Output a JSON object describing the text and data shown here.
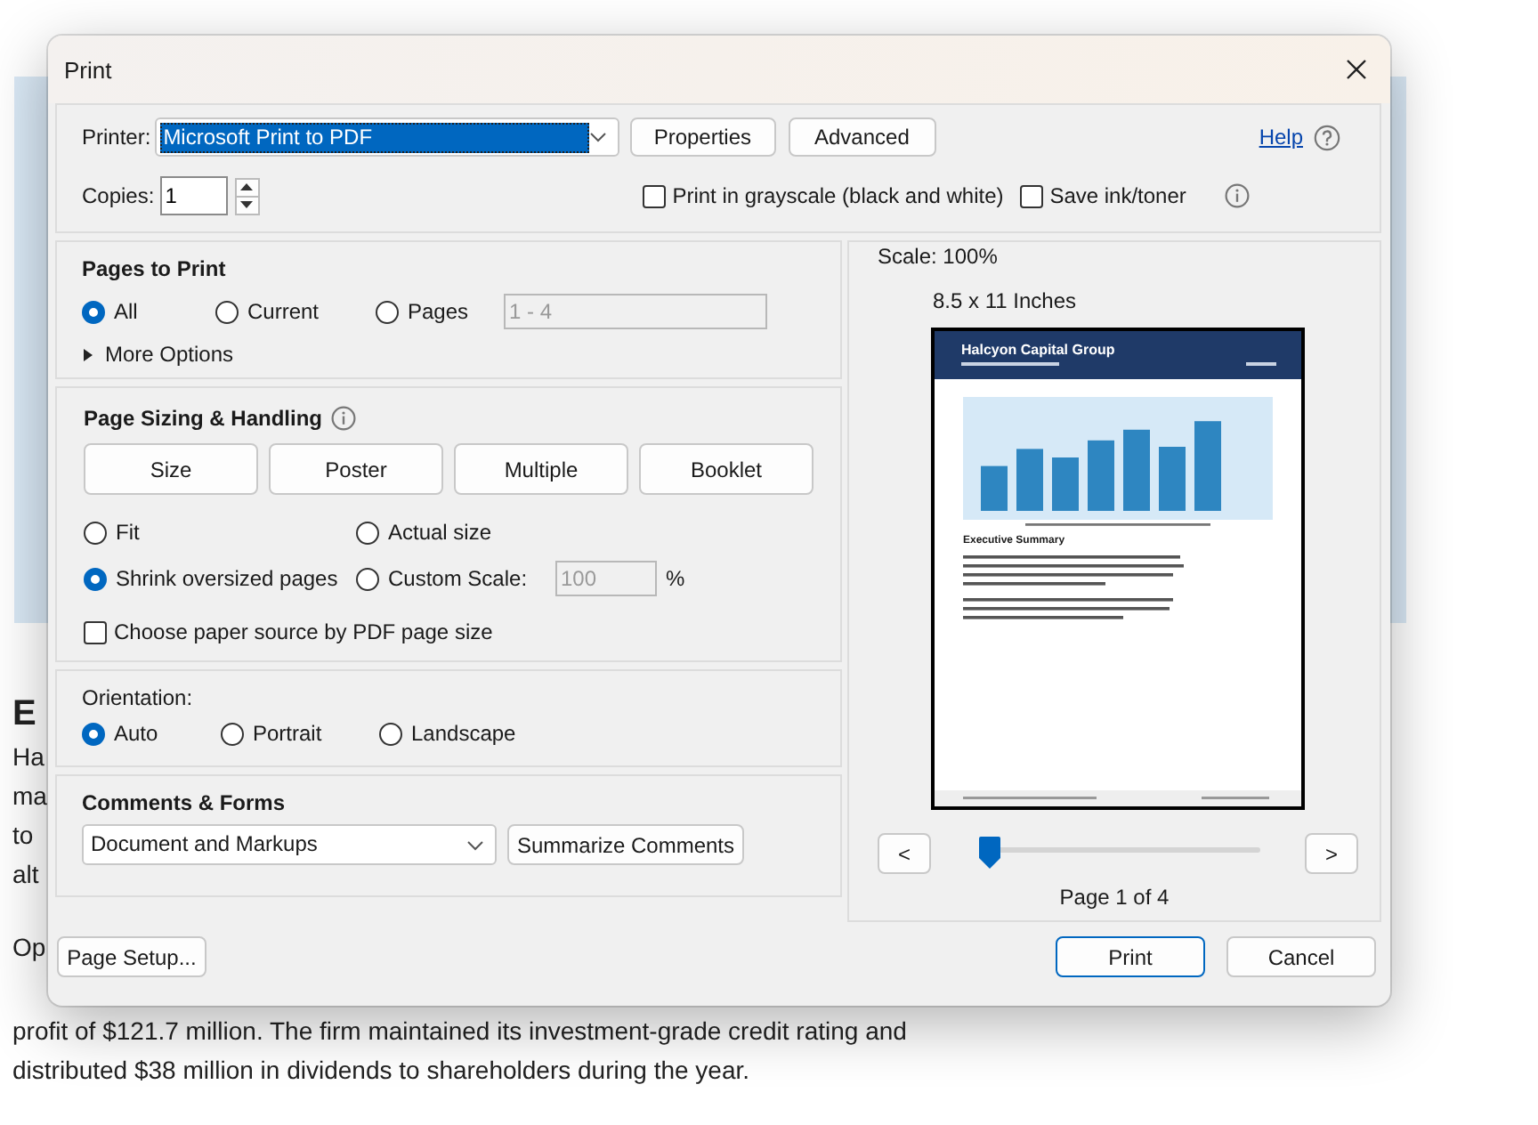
{
  "background_document": {
    "heading": "E",
    "paragraph_1": [
      "Ha",
      "ma",
      "to",
      "alt"
    ],
    "paragraph_2": [
      "Op",
      "profit of $121.7 million. The firm maintained its investment-grade credit rating and",
      "distributed $38 million in dividends to shareholders during the year."
    ]
  },
  "dialog": {
    "title": "Print",
    "printer": {
      "label": "Printer:",
      "value": "Microsoft Print to PDF",
      "focused": true
    },
    "printer_buttons": [
      "Properties",
      "Advanced"
    ],
    "help_link": "Help",
    "copies": {
      "label": "Copies:",
      "value": "1"
    },
    "output_options": [
      {
        "label": "Print in grayscale (black and white)",
        "checked": false
      },
      {
        "label": "Save ink/toner",
        "checked": false
      }
    ],
    "pages_to_print": {
      "title": "Pages to Print",
      "options": [
        {
          "label": "All",
          "selected": true
        },
        {
          "label": "Current",
          "selected": false
        },
        {
          "label": "Pages",
          "selected": false
        }
      ],
      "range": {
        "value": "1 - 4",
        "disabled": true
      },
      "more_options": {
        "label": "More Options",
        "expanded": false
      }
    },
    "page_sizing": {
      "title": "Page Sizing & Handling",
      "modes": [
        "Size",
        "Poster",
        "Multiple",
        "Booklet"
      ],
      "scaling": [
        {
          "label": "Fit",
          "selected": false
        },
        {
          "label": "Actual size",
          "selected": false
        },
        {
          "label": "Shrink oversized pages",
          "selected": true
        },
        {
          "label": "Custom Scale:",
          "selected": false
        }
      ],
      "custom_scale": {
        "value": "100",
        "disabled": true
      },
      "unit": "%",
      "paper_source": {
        "label": "Choose paper source by PDF page size",
        "checked": false
      }
    },
    "orientation": {
      "title": "Orientation:",
      "options": [
        {
          "label": "Auto",
          "selected": true
        },
        {
          "label": "Portrait",
          "selected": false
        },
        {
          "label": "Landscape",
          "selected": false
        }
      ]
    },
    "comments_forms": {
      "title": "Comments & Forms",
      "value": "Document and Markups",
      "button": "Summarize Comments"
    },
    "preview": {
      "scale": "Scale: 100%",
      "paper_size": "8.5 x 11 Inches",
      "document": {
        "title": "Halcyon Capital Group",
        "heading": "Executive Summary"
      },
      "previous": "<",
      "next": ">",
      "slider": {
        "level": 0
      },
      "page": "Page 1 of 4"
    },
    "footer_buttons": [
      {
        "label": "Page Setup...",
        "default": false
      },
      {
        "label": "Print",
        "default": true
      },
      {
        "label": "Cancel",
        "default": false
      }
    ]
  }
}
